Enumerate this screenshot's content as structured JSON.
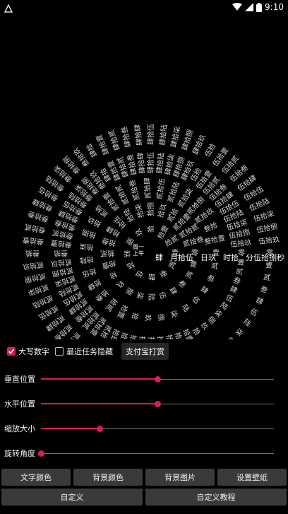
{
  "status_bar": {
    "time": "9:10",
    "icons": [
      "notification-icon",
      "wifi-icon",
      "signal-icon",
      "battery-icon"
    ]
  },
  "clock": {
    "center_lines": [
      "周一",
      "上午"
    ],
    "hands_text": [
      "肆",
      "月拾伍",
      "日玖",
      "时拾",
      "分伍拾捌秒"
    ],
    "text_color": "#d6d6d6"
  },
  "options": {
    "uppercase_digits": {
      "label": "大写数字",
      "checked": true
    },
    "hide_recent": {
      "label": "最近任务隐藏",
      "checked": false
    },
    "alipay_button": "支付宝打赏"
  },
  "sliders": [
    {
      "label": "垂直位置",
      "value": 0.5
    },
    {
      "label": "水平位置",
      "value": 0.5
    },
    {
      "label": "缩放大小",
      "value": 0.25
    },
    {
      "label": "旋转角度",
      "value": 0.0
    }
  ],
  "buttons": {
    "text_color": "文字颜色",
    "bg_color": "背景颜色",
    "bg_image": "背景图片",
    "set_wallpaper": "设置壁纸",
    "custom": "自定义",
    "custom_tutorial": "自定义教程"
  },
  "accent_color": "#d81b60"
}
